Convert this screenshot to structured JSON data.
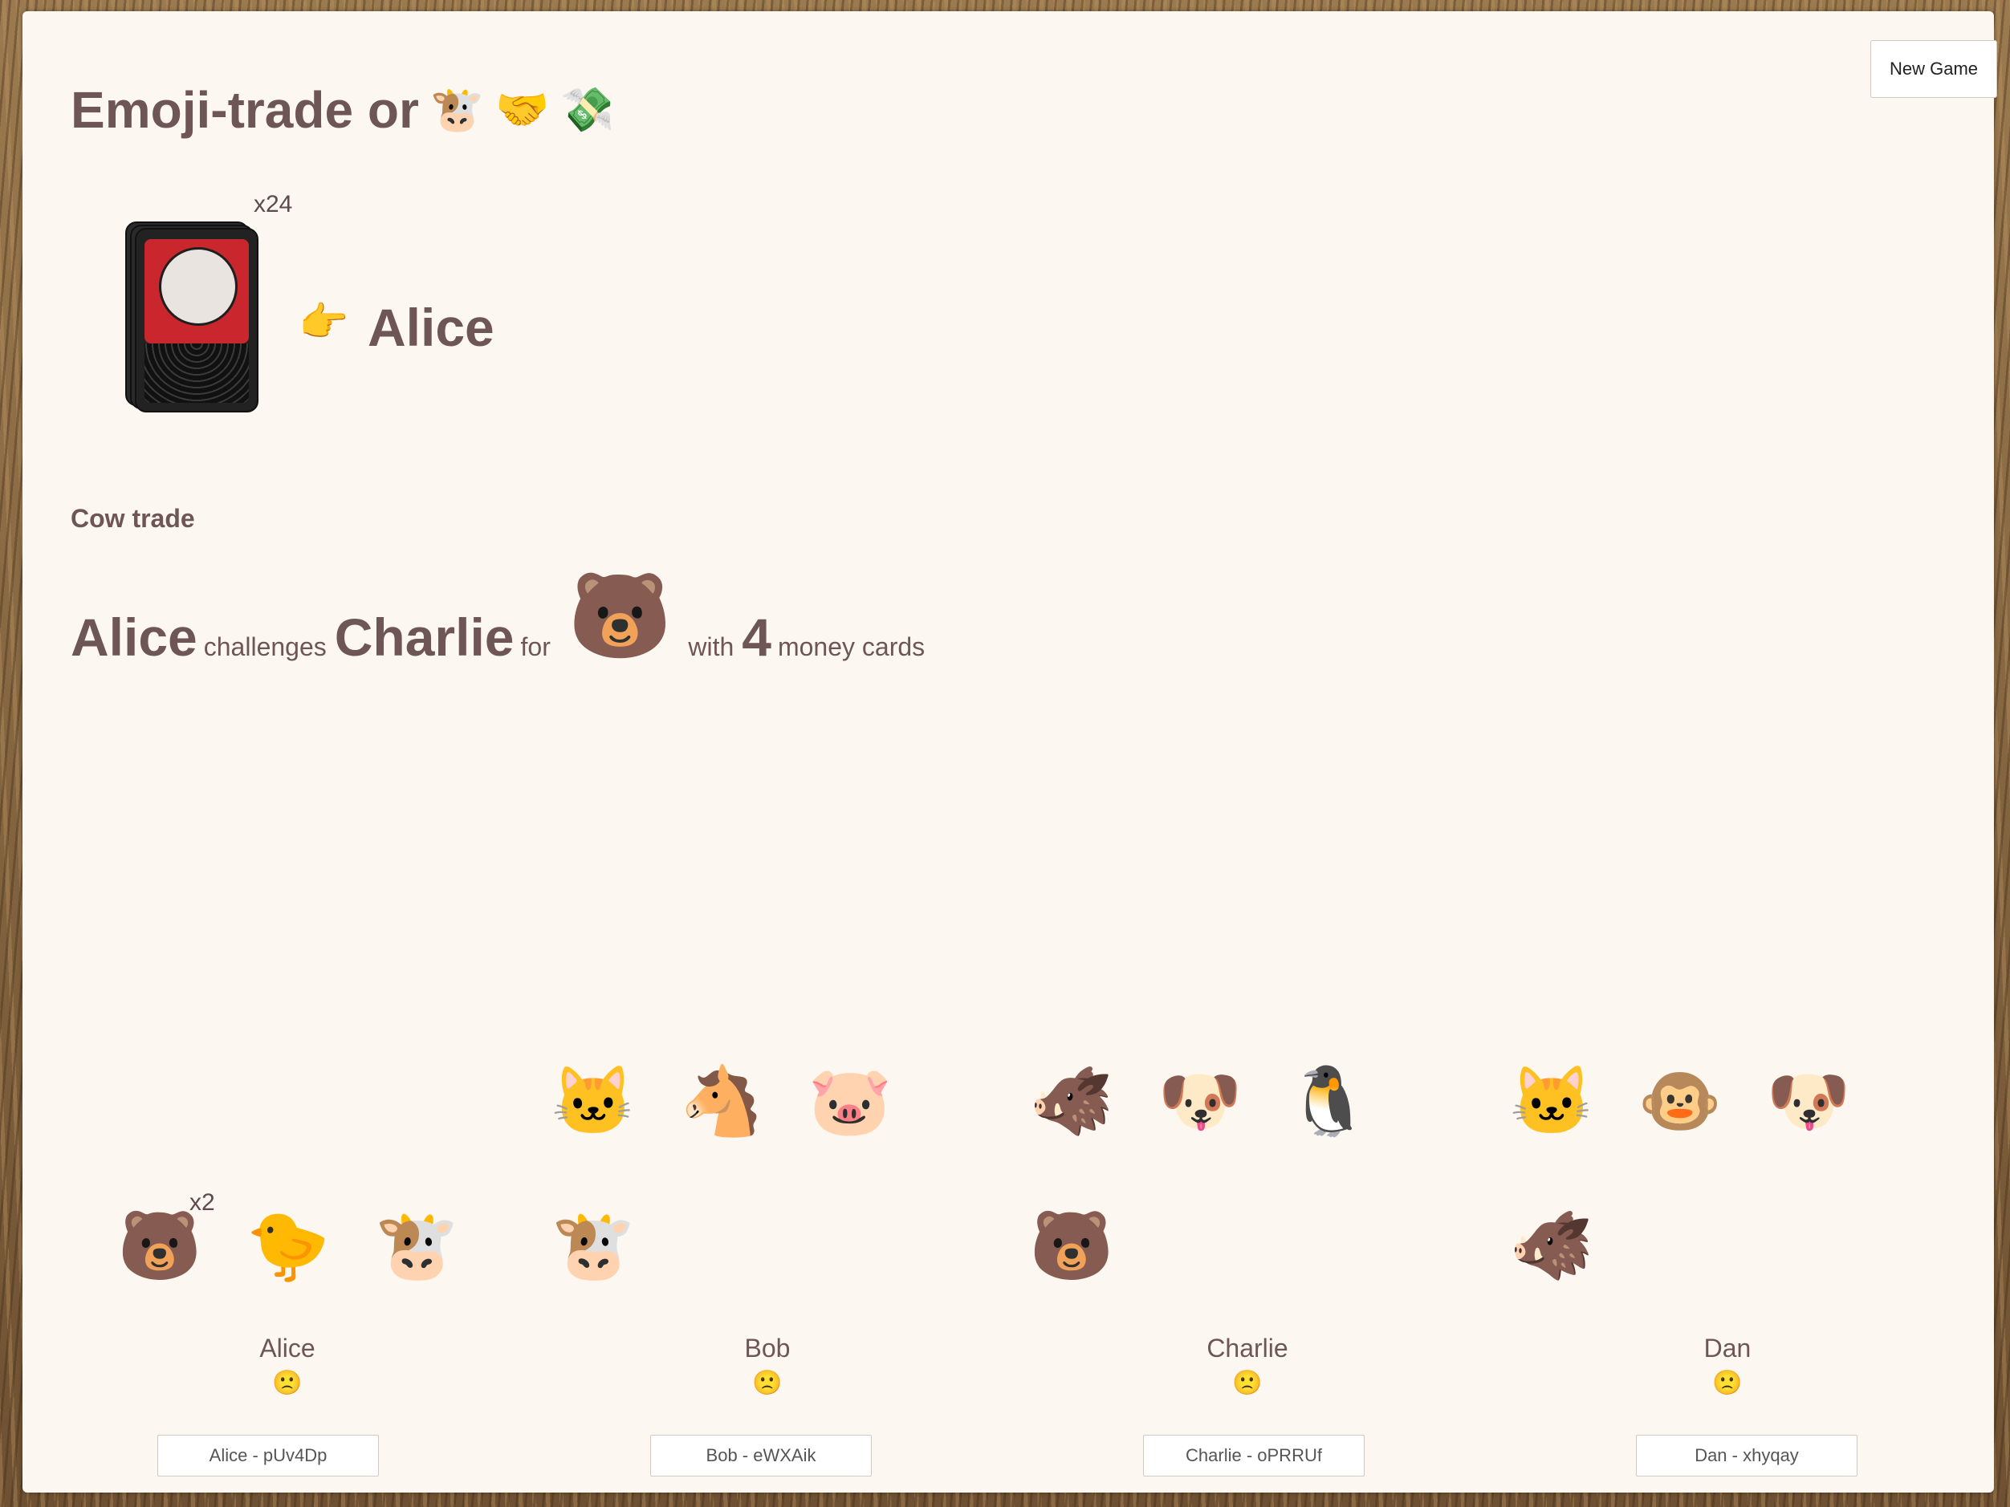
{
  "title": {
    "text": "Emoji-trade or",
    "emojis": [
      "🐮",
      "🤝",
      "💸"
    ]
  },
  "new_game_label": "New Game",
  "deck": {
    "count_label": "x24"
  },
  "turn": {
    "pointer": "👉",
    "player": "Alice"
  },
  "section_label": "Cow trade",
  "challenge": {
    "challenger": "Alice",
    "verb": "challenges",
    "target": "Charlie",
    "for_word": "for",
    "animal": "🐻",
    "with_word": "with",
    "money_count": "4",
    "money_label": "money cards"
  },
  "players": [
    {
      "name": "Alice",
      "mood": "🙁",
      "id_label": "Alice  - pUv4Dp",
      "top_row": [],
      "bottom_row": [
        {
          "emoji": "🐻",
          "count": "x2"
        },
        {
          "emoji": "🐤"
        },
        {
          "emoji": "🐮"
        }
      ]
    },
    {
      "name": "Bob",
      "mood": "🙁",
      "id_label": "Bob  - eWXAik",
      "top_row": [
        {
          "emoji": "🐱"
        },
        {
          "emoji": "🐴"
        },
        {
          "emoji": "🐷"
        }
      ],
      "bottom_row": [
        {
          "emoji": "🐮"
        }
      ]
    },
    {
      "name": "Charlie",
      "mood": "🙁",
      "id_label": "Charlie  - oPRRUf",
      "top_row": [
        {
          "emoji": "🐗"
        },
        {
          "emoji": "🐶"
        },
        {
          "emoji": "🐧"
        }
      ],
      "bottom_row": [
        {
          "emoji": "🐻"
        }
      ]
    },
    {
      "name": "Dan",
      "mood": "🙁",
      "id_label": "Dan  - xhyqay",
      "top_row": [
        {
          "emoji": "🐱"
        },
        {
          "emoji": "🐵"
        },
        {
          "emoji": "🐶"
        }
      ],
      "bottom_row": [
        {
          "emoji": "🐗"
        }
      ]
    }
  ]
}
